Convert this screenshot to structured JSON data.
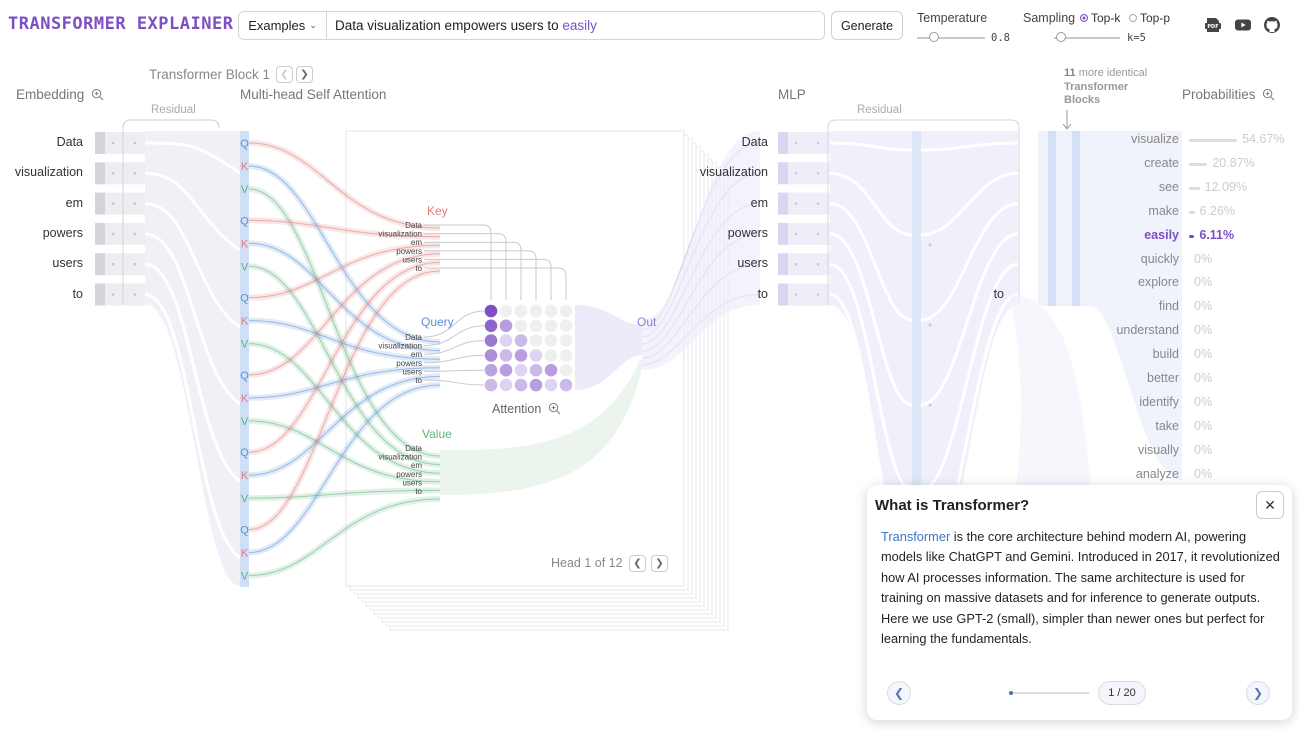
{
  "app": {
    "title": "Transformer Explainer"
  },
  "toolbar": {
    "examples_label": "Examples",
    "prompt_text": "Data visualization empowers users to",
    "prompt_highlight": "easily",
    "generate_label": "Generate",
    "temperature_label": "Temperature",
    "temperature_value": "0.8",
    "temperature_level": 0.25,
    "sampling_label": "Sampling",
    "topk_label": "Top-k",
    "topp_label": "Top-p",
    "topk_selected": true,
    "k_value": "k=5",
    "k_level": 0.1,
    "icons": [
      "pdf-icon",
      "youtube-icon",
      "github-icon"
    ]
  },
  "sections": {
    "block_label": "Transformer Block 1",
    "embedding": "Embedding",
    "attention": "Multi-head Self Attention",
    "residual": "Residual",
    "mlp": "MLP",
    "residual2": "Residual",
    "more_blocks_count": "11",
    "more_blocks_text1": "more identical",
    "more_blocks_text2": "Transformer",
    "more_blocks_text3": "Blocks",
    "probabilities": "Probabilities",
    "key": "Key",
    "query": "Query",
    "value": "Value",
    "out": "Out",
    "attention_label": "Attention",
    "head_label": "Head 1 of 12"
  },
  "tokens": [
    "Data",
    "visualization",
    "em",
    "powers",
    "users",
    "to"
  ],
  "last_token": "to",
  "qkv_letters": [
    "Q",
    "K",
    "V"
  ],
  "probabilities": [
    {
      "word": "visualize",
      "value": "54.67%",
      "p": 0.5467
    },
    {
      "word": "create",
      "value": "20.87%",
      "p": 0.2087
    },
    {
      "word": "see",
      "value": "12.09%",
      "p": 0.1209
    },
    {
      "word": "make",
      "value": "6.26%",
      "p": 0.0626
    },
    {
      "word": "easily",
      "value": "6.11%",
      "p": 0.0611,
      "selected": true
    },
    {
      "word": "quickly",
      "value": "0%",
      "p": 0
    },
    {
      "word": "explore",
      "value": "0%",
      "p": 0
    },
    {
      "word": "find",
      "value": "0%",
      "p": 0
    },
    {
      "word": "understand",
      "value": "0%",
      "p": 0
    },
    {
      "word": "build",
      "value": "0%",
      "p": 0
    },
    {
      "word": "better",
      "value": "0%",
      "p": 0
    },
    {
      "word": "identify",
      "value": "0%",
      "p": 0
    },
    {
      "word": "take",
      "value": "0%",
      "p": 0
    },
    {
      "word": "visually",
      "value": "0%",
      "p": 0
    },
    {
      "word": "analyze",
      "value": "0%",
      "p": 0
    }
  ],
  "colors": {
    "accent": "#7d4fc2",
    "query": "#5b8fd6",
    "key": "#e07a7a",
    "value": "#5fb37a",
    "link": "#3a78c9"
  },
  "popup": {
    "title": "What is Transformer?",
    "link_word": "Transformer",
    "body": " is the core architecture behind modern AI, powering models like ChatGPT and Gemini. Introduced in 2017, it revolutionized how AI processes information. The same architecture is used for training on massive datasets and for inference to generate outputs. Here we use GPT-2 (small), simpler than newer ones but perfect for learning the fundamentals.",
    "page": "1 / 20",
    "progress": 0.05
  }
}
